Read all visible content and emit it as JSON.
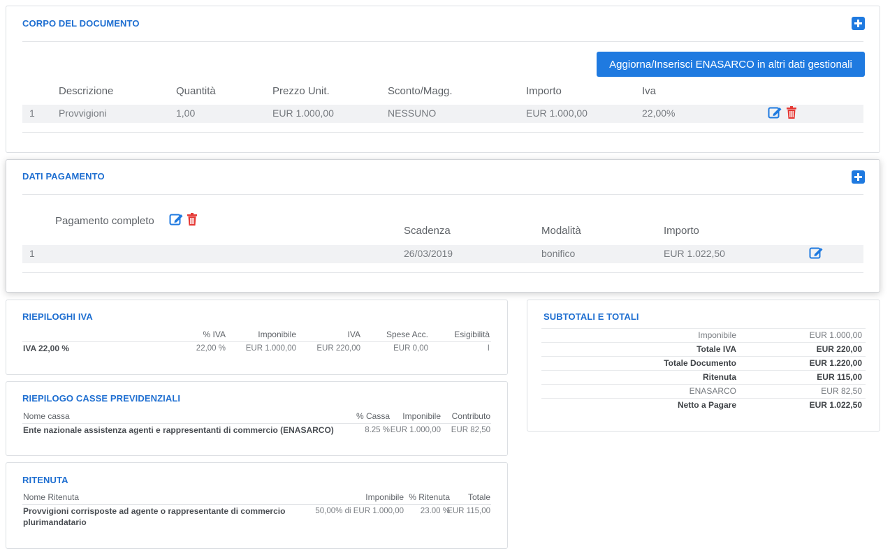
{
  "corpo": {
    "title": "CORPO DEL DOCUMENTO",
    "enasarco_button": "Aggiorna/Inserisci ENASARCO in altri dati gestionali",
    "headers": [
      "Descrizione",
      "Quantità",
      "Prezzo Unit.",
      "Sconto/Magg.",
      "Importo",
      "Iva"
    ],
    "row": {
      "num": "1",
      "descrizione": "Provvigioni",
      "quantita": "1,00",
      "prezzo": "EUR 1.000,00",
      "sconto": "NESSUNO",
      "importo": "EUR 1.000,00",
      "iva": "22,00%"
    }
  },
  "pagamento": {
    "title": "DATI PAGAMENTO",
    "label": "Pagamento completo",
    "headers": [
      "Scadenza",
      "Modalità",
      "Importo"
    ],
    "row": {
      "num": "1",
      "scadenza": "26/03/2019",
      "modalita": "bonifico",
      "importo": "EUR 1.022,50"
    }
  },
  "riepiloghi_iva": {
    "title": "RIEPILOGHI IVA",
    "headers": [
      "% IVA",
      "Imponibile",
      "IVA",
      "Spese Acc.",
      "Esigibilità"
    ],
    "row": {
      "label": "IVA 22,00 %",
      "perc": "22,00 %",
      "imponibile": "EUR 1.000,00",
      "iva": "EUR 220,00",
      "spese": "EUR 0,00",
      "esigibilita": "I"
    }
  },
  "casse": {
    "title": "RIEPILOGO CASSE PREVIDENZIALI",
    "headers": [
      "Nome cassa",
      "% Cassa",
      "Imponibile",
      "Contributo"
    ],
    "row": {
      "nome": "Ente nazionale assistenza agenti e rappresentanti di commercio (ENASARCO)",
      "perc": "8.25 %",
      "imponibile": "EUR 1.000,00",
      "contributo": "EUR 82,50"
    }
  },
  "ritenuta": {
    "title": "RITENUTA",
    "headers": [
      "Nome Ritenuta",
      "Imponibile",
      "% Ritenuta",
      "Totale"
    ],
    "row": {
      "nome_line1": "Provvigioni corrisposte ad agente o rappresentante di commercio",
      "nome_line2": "plurimandatario",
      "imponibile": "50,00% di EUR 1.000,00",
      "perc": "23.00 %",
      "totale": "EUR 115,00"
    }
  },
  "totali": {
    "title": "SUBTOTALI E TOTALI",
    "rows": [
      {
        "label": "Imponibile",
        "value": "EUR 1.000,00",
        "bold": false
      },
      {
        "label": "Totale IVA",
        "value": "EUR 220,00",
        "bold": true
      },
      {
        "label": "Totale Documento",
        "value": "EUR 1.220,00",
        "bold": true
      },
      {
        "label": "Ritenuta",
        "value": "EUR 115,00",
        "bold": true
      },
      {
        "label": "ENASARCO",
        "value": "EUR 82,50",
        "bold": false
      },
      {
        "label": "Netto a Pagare",
        "value": "EUR 1.022,50",
        "bold": true
      }
    ]
  },
  "colors": {
    "accent": "#1f7ae0",
    "title": "#1f6fd1",
    "delete": "#e53935"
  },
  "icons": {
    "add": "plus-square-icon",
    "edit": "edit-icon",
    "delete": "trash-icon"
  }
}
